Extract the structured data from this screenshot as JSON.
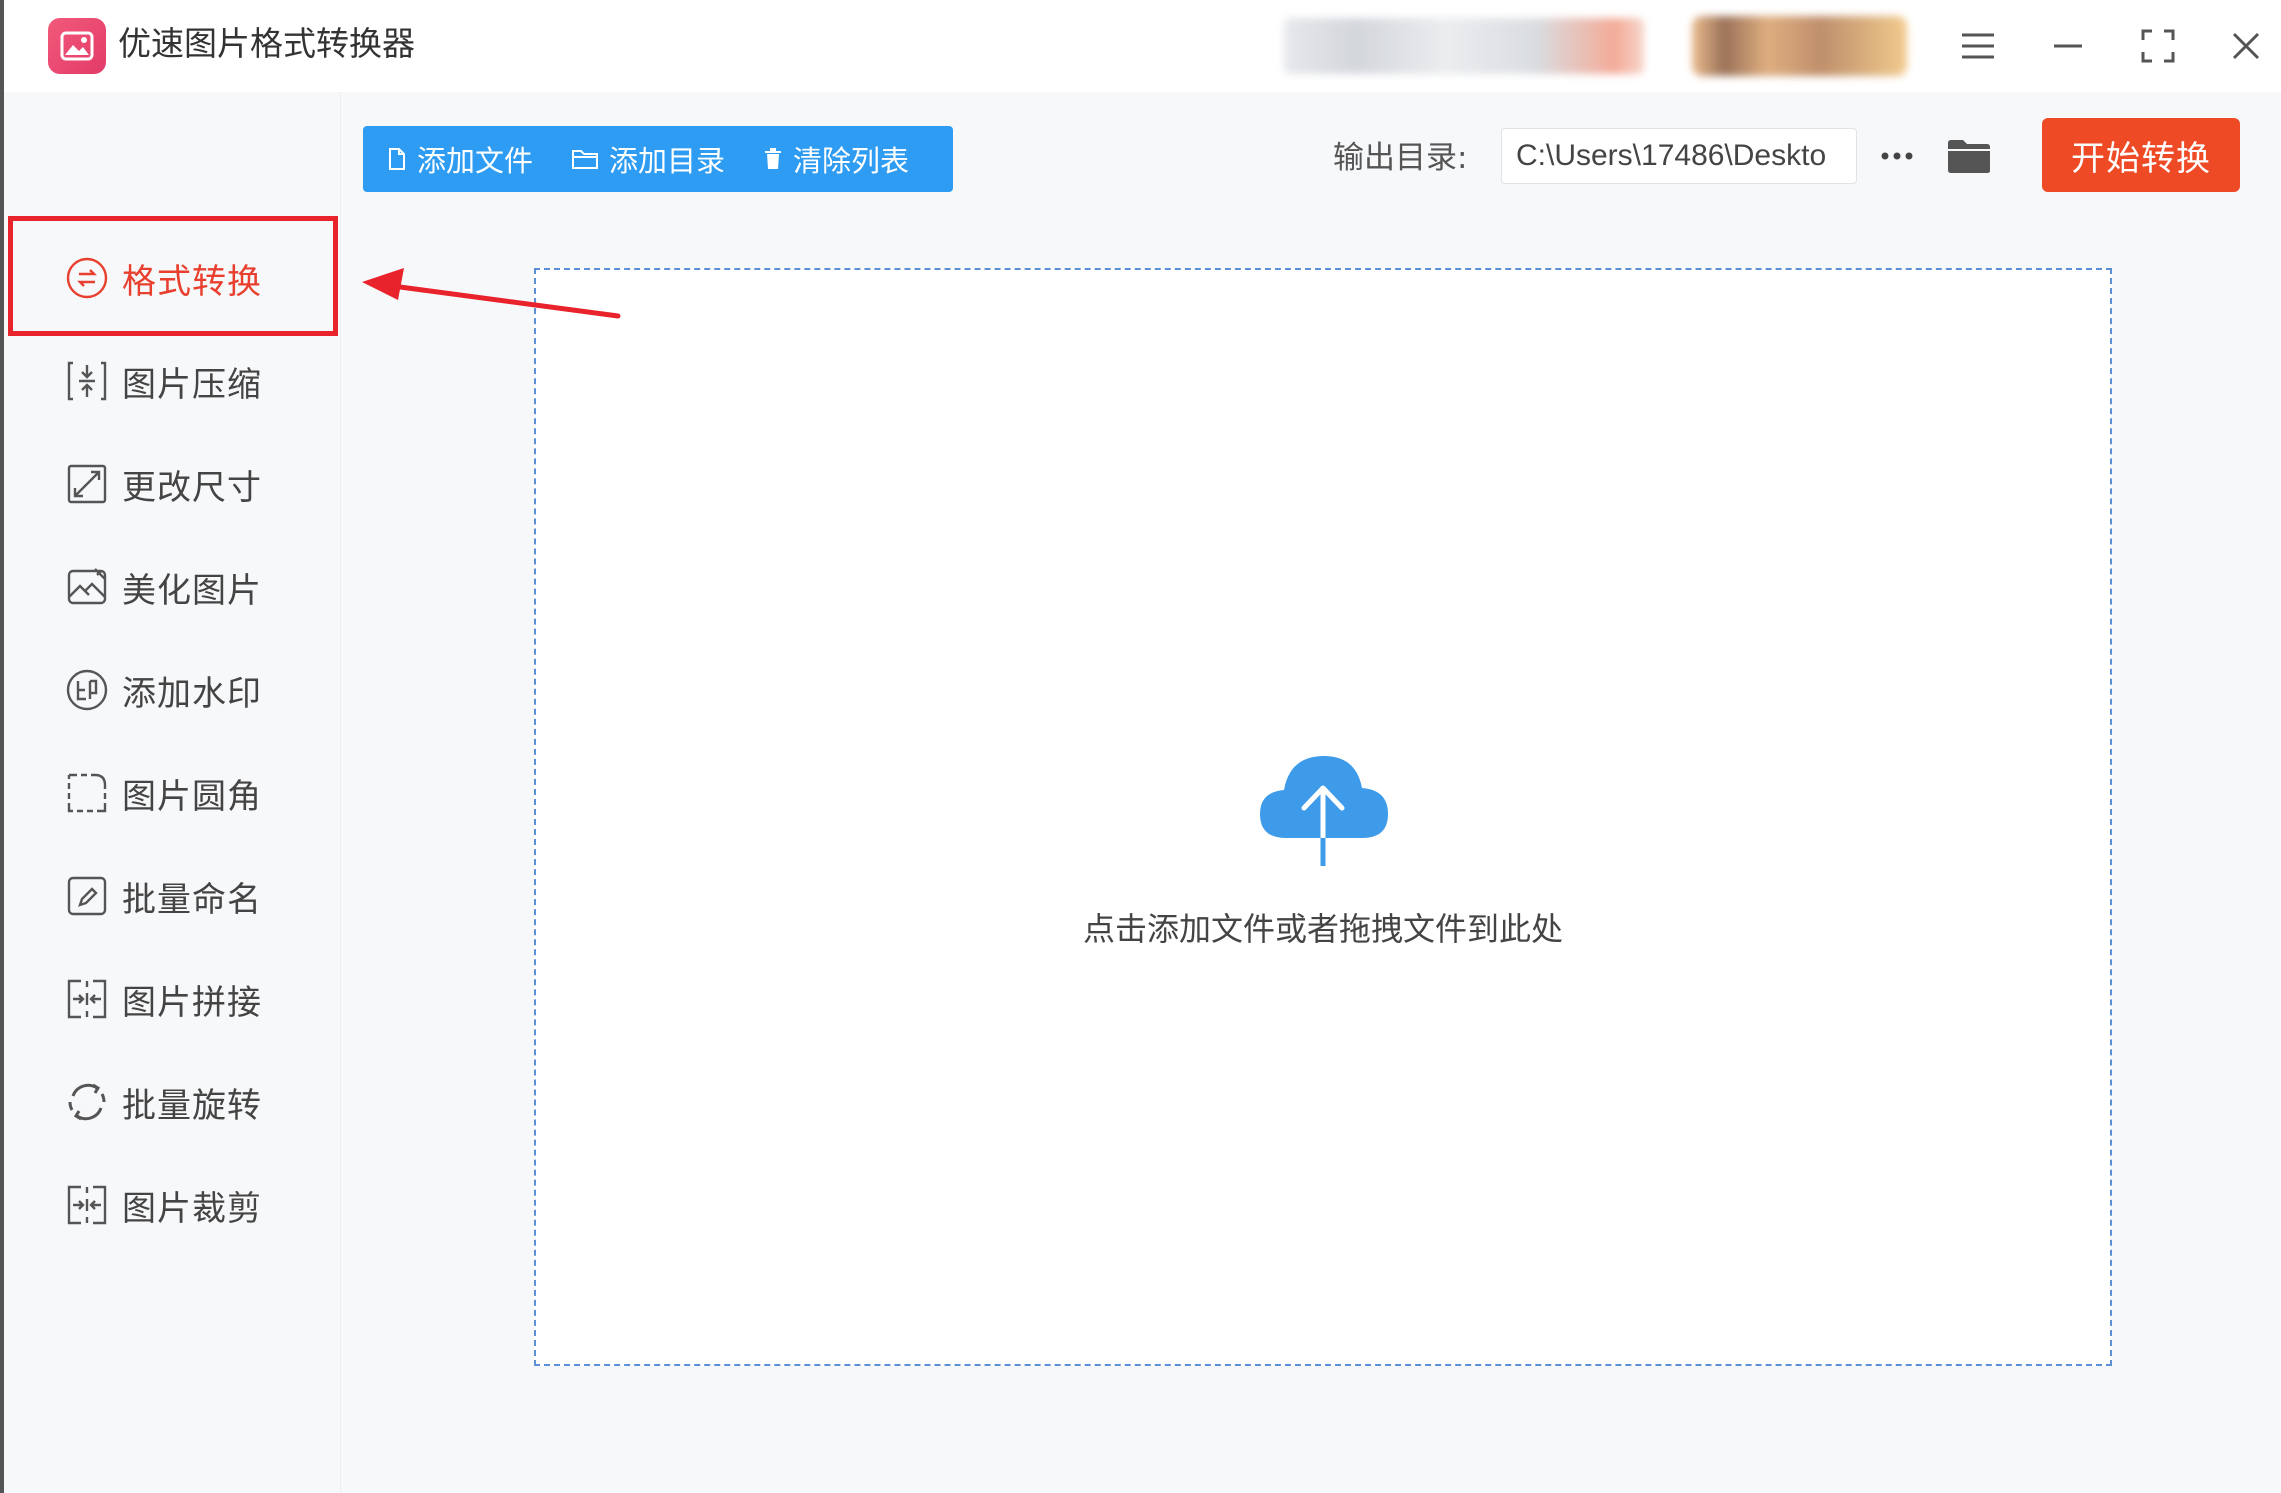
{
  "app": {
    "title": "优速图片格式转换器"
  },
  "titlebar_controls": [
    "menu-icon",
    "minimize-icon",
    "maximize-icon",
    "close-icon"
  ],
  "sidebar": {
    "active_index": 0,
    "items": [
      {
        "label": "格式转换",
        "icon": "format-convert-icon"
      },
      {
        "label": "图片压缩",
        "icon": "compress-icon"
      },
      {
        "label": "更改尺寸",
        "icon": "resize-icon"
      },
      {
        "label": "美化图片",
        "icon": "beautify-icon"
      },
      {
        "label": "添加水印",
        "icon": "watermark-icon"
      },
      {
        "label": "图片圆角",
        "icon": "rounded-corner-icon"
      },
      {
        "label": "批量命名",
        "icon": "rename-icon"
      },
      {
        "label": "图片拼接",
        "icon": "stitch-icon"
      },
      {
        "label": "批量旋转",
        "icon": "rotate-icon"
      },
      {
        "label": "图片裁剪",
        "icon": "crop-icon"
      }
    ]
  },
  "toolbar": {
    "add_file": "添加文件",
    "add_folder": "添加目录",
    "clear_list": "清除列表",
    "output_label": "输出目录:",
    "output_path": "C:\\Users\\17486\\Deskto",
    "more": "···",
    "start": "开始转换"
  },
  "dropzone": {
    "hint": "点击添加文件或者拖拽文件到此处"
  },
  "colors": {
    "accent_blue": "#2e9cf2",
    "start_orange": "#ee4a26",
    "highlight_red": "#e8232b",
    "active_text": "#e83f2e"
  }
}
